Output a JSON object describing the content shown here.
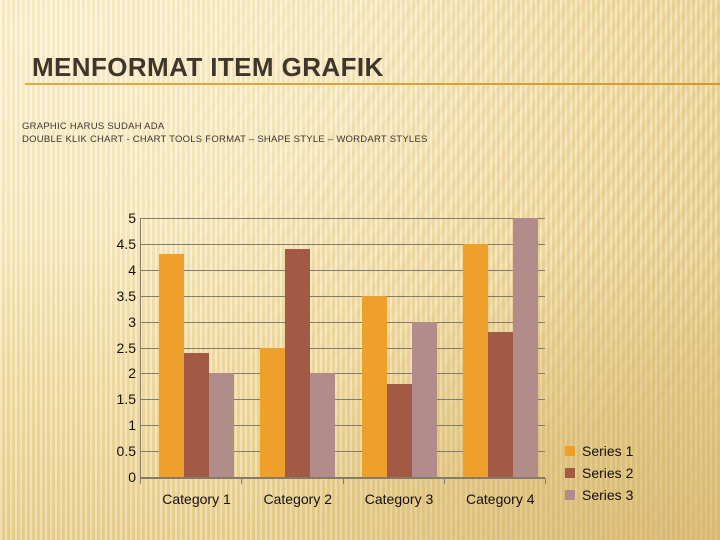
{
  "slide": {
    "title": "MENFORMAT ITEM GRAFIK",
    "body_lines": [
      "GRAPHIC HARUS SUDAH ADA",
      "DOUBLE KLIK  CHART -  CHART TOOLS FORMAT – SHAPE STYLE – WORDART STYLES"
    ]
  },
  "colors": {
    "title_text": "#3f362b",
    "title_rule": "#d9a234",
    "series_1": "#efa02a",
    "series_2": "#a35a44",
    "series_3": "#b28c8a",
    "gridline": "#847b6d",
    "background": "#faecc4"
  },
  "chart_data": {
    "type": "bar",
    "title": "",
    "xlabel": "",
    "ylabel": "",
    "ylim": [
      0,
      5
    ],
    "grid": true,
    "legend_position": "right-bottom",
    "categories": [
      "Category 1",
      "Category 2",
      "Category 3",
      "Category 4"
    ],
    "ytick_labels": [
      "0",
      "0.5",
      "1",
      "1.5",
      "2",
      "2.5",
      "3",
      "3.5",
      "4",
      "4.5",
      "5"
    ],
    "ytick_values": [
      0,
      0.5,
      1,
      1.5,
      2,
      2.5,
      3,
      3.5,
      4,
      4.5,
      5
    ],
    "series": [
      {
        "name": "Series 1",
        "color": "#efa02a",
        "values": [
          4.3,
          2.5,
          3.5,
          4.5
        ]
      },
      {
        "name": "Series 2",
        "color": "#a35a44",
        "values": [
          2.4,
          4.4,
          1.8,
          2.8
        ]
      },
      {
        "name": "Series 3",
        "color": "#b28c8a",
        "values": [
          2.0,
          2.0,
          3.0,
          5.0
        ]
      }
    ]
  }
}
